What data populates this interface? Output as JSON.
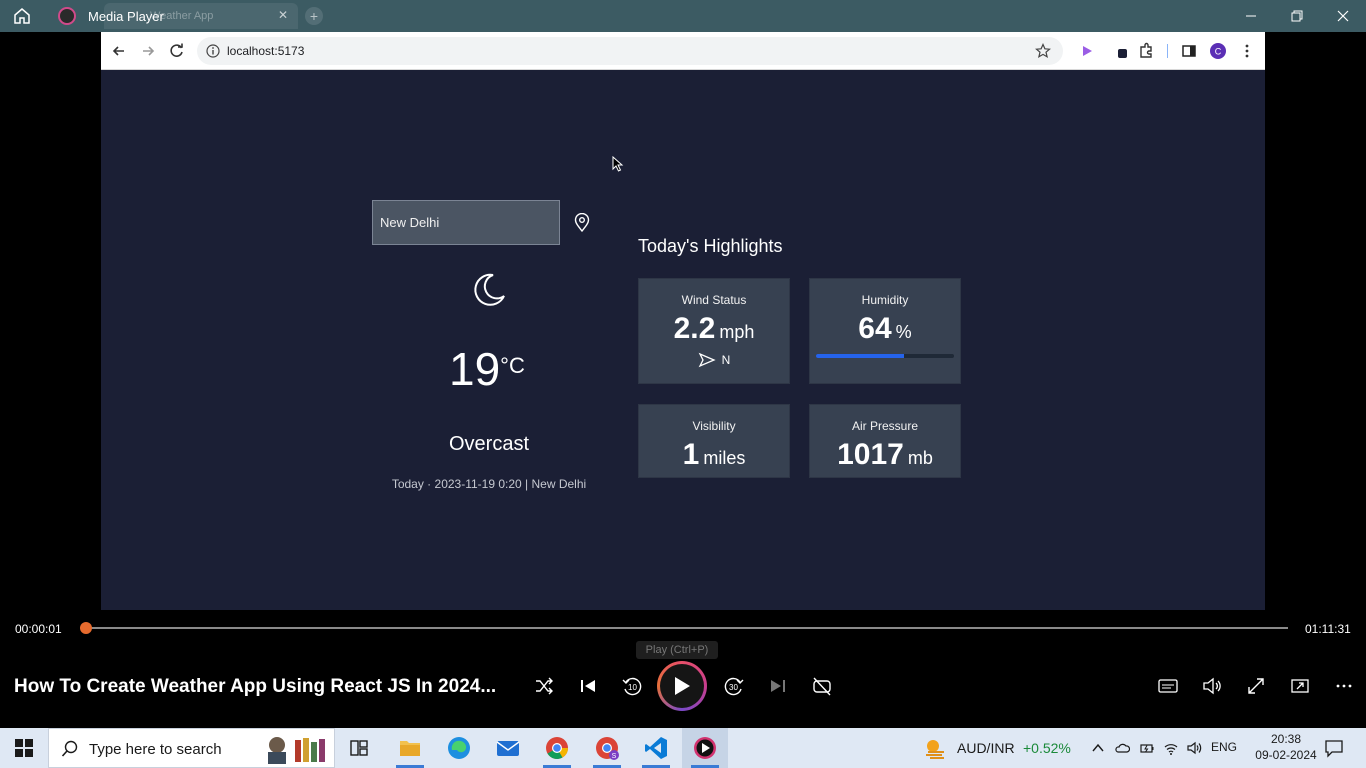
{
  "player": {
    "title": "Media Player",
    "ghost_tab_label": "Weather App",
    "video_title": "How To Create Weather App Using React JS In 2024...",
    "time_elapsed": "00:00:01",
    "time_total": "01:11:31",
    "progress": 0.0,
    "tooltip": "Play (Ctrl+P)",
    "controls": [
      "shuffle-icon",
      "previous-icon",
      "rewind-10-icon",
      "play-icon",
      "forward-30-icon",
      "next-icon",
      "repeat-icon",
      "captions-icon",
      "volume-icon",
      "fullscreen-icon",
      "miniplayer-icon",
      "more-icon"
    ]
  },
  "browser": {
    "url": "localhost:5173"
  },
  "weather": {
    "search_value": "New Delhi",
    "temperature": "19",
    "unit": "°C",
    "condition": "Overcast",
    "date_line": "Today · 2023-11-19 0:20 | New Delhi",
    "highlights_title": "Today's Highlights",
    "wind": {
      "label": "Wind Status",
      "value": "2.2",
      "unit": "mph",
      "direction": "N"
    },
    "humidity": {
      "label": "Humidity",
      "value": "64",
      "unit": "%",
      "percent": 64
    },
    "visibility": {
      "label": "Visibility",
      "value": "1",
      "unit": "miles"
    },
    "pressure": {
      "label": "Air Pressure",
      "value": "1017",
      "unit": "mb"
    }
  },
  "taskbar": {
    "search_placeholder": "Type here to search",
    "ticker_label": "AUD/INR",
    "ticker_change": "+0.52%",
    "language": "ENG",
    "time": "20:38",
    "date": "09-02-2024",
    "apps": [
      "task-view-icon",
      "file-explorer-icon",
      "edge-icon",
      "mail-icon",
      "chrome-icon",
      "chrome-profile-icon",
      "vscode-icon",
      "media-player-icon"
    ]
  },
  "colors": {
    "app_bg": "#1b1f35",
    "card_bg": "#374151",
    "humidity_bar": "#2563eb",
    "seek_thumb": "#e66b2e",
    "ticker_positive": "#1b8a3a"
  }
}
